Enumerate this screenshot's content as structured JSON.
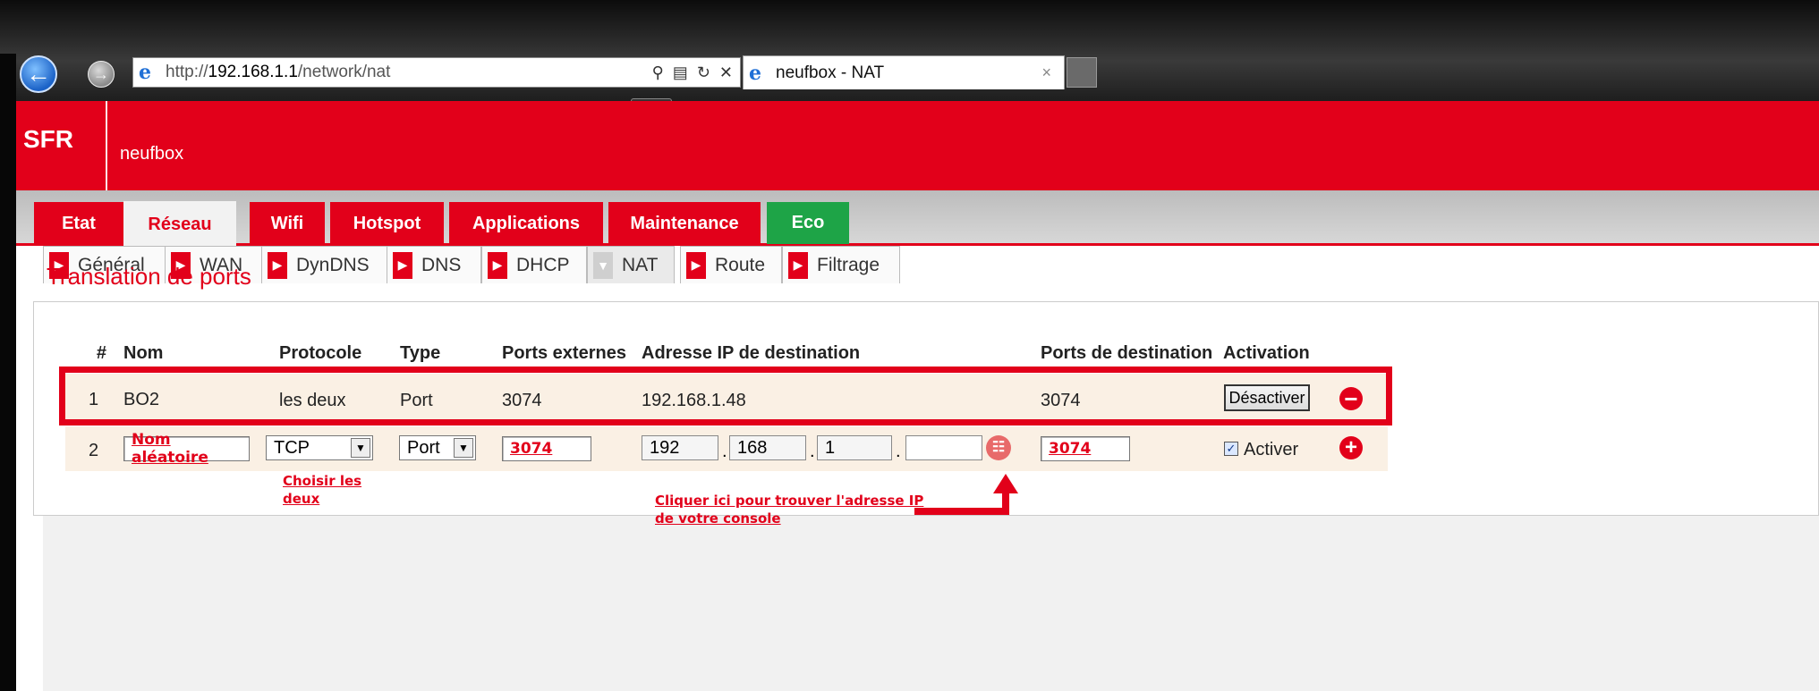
{
  "browser": {
    "back_icon": "back-arrow-icon",
    "url_prefix": "http://",
    "url_host": "192.168.1.1",
    "url_path": "/network/nat",
    "tab_title": "neufbox - NAT",
    "tab_close": "×"
  },
  "header": {
    "logo": "SFR",
    "brand": "neufbox"
  },
  "main_nav": [
    {
      "label": "Etat"
    },
    {
      "label": "Réseau"
    },
    {
      "label": "Wifi"
    },
    {
      "label": "Hotspot"
    },
    {
      "label": "Applications"
    },
    {
      "label": "Maintenance"
    },
    {
      "label": "Eco"
    }
  ],
  "sub_tabs": [
    {
      "label": "Général"
    },
    {
      "label": "WAN"
    },
    {
      "label": "DynDNS"
    },
    {
      "label": "DNS"
    },
    {
      "label": "DHCP"
    },
    {
      "label": "NAT"
    },
    {
      "label": "Route"
    },
    {
      "label": "Filtrage"
    }
  ],
  "page_title": "Translation de ports",
  "table": {
    "headers": [
      "#",
      "Nom",
      "Protocole",
      "Type",
      "Ports externes",
      "Adresse IP de destination",
      "Ports de destination",
      "Activation"
    ],
    "row1": {
      "num": "1",
      "nom": "BO2",
      "protocole": "les deux",
      "type": "Port",
      "ports_ext": "3074",
      "ip": "192.168.1.48",
      "ports_dest": "3074",
      "button": "Désactiver"
    },
    "row2": {
      "num": "2",
      "nom": "Nom aléatoire",
      "protocole": "TCP",
      "type": "Port",
      "ports_ext": "3074",
      "ip1": "192",
      "ip2": "168",
      "ip3": "1",
      "ip4": "",
      "ports_dest": "3074",
      "activer": "Activer"
    }
  },
  "annotations": {
    "protocol_line1": "Choisir les",
    "protocol_line2": "deux",
    "ip_line1": "Cliquer ici pour trouver l'adresse IP",
    "ip_line2": "de votre console"
  },
  "colors": {
    "brand_red": "#e2001a",
    "eco_green": "#1ea447"
  }
}
